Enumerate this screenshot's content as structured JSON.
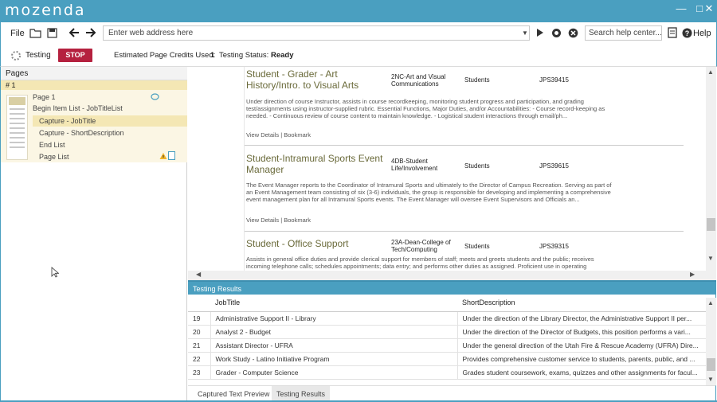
{
  "app": {
    "logo": "mozenda",
    "win_minimize": "—",
    "win_maximize": "□",
    "win_close": "✕"
  },
  "toolbar": {
    "file_label": "File",
    "address_placeholder": "Enter web address here",
    "search_placeholder": "Search help center...",
    "help_label": "Help",
    "icons": [
      "open-folder-icon",
      "save-icon",
      "back-arrow-icon",
      "forward-arrow-icon",
      "play-icon",
      "refresh-icon",
      "stop-circle-icon",
      "document-icon",
      "help-circle-icon"
    ]
  },
  "status": {
    "testing_label": "Testing",
    "stop_label": "STOP",
    "credits_label": "Estimated Page Credits Used:",
    "credits_value": "1",
    "status_label": "Testing Status:",
    "status_value": "Ready"
  },
  "pages_panel": {
    "header": "Pages",
    "page_number": "# 1",
    "items": [
      "Page 1",
      "Begin Item List - JobTitleList",
      "Capture - JobTitle",
      "Capture - ShortDescription",
      "End List",
      "Page List"
    ],
    "selected_index": 2
  },
  "web_page": {
    "jobs": [
      {
        "title": "Student - Grader - Art History/Intro. to Visual Arts",
        "dept": "2NC-Art and Visual Communications",
        "type": "Students",
        "id": "JPS39415",
        "desc": "Under direction of course Instructor, assists in course recordkeeping, monitoring student progress and participation, and grading test/assignments using instructor-supplied rubric. Essential Functions, Major Duties, and/or Accountabilities: - Course record-keeping as needed. - Continuous review of course content to maintain knowledge. - Logistical student interactions through email/ph...",
        "links": "View Details | Bookmark"
      },
      {
        "title": "Student-Intramural Sports Event Manager",
        "dept": "4DB-Student Life/Involvement",
        "type": "Students",
        "id": "JPS39615",
        "desc": "The Event Manager reports to the Coordinator of Intramural Sports and ultimately to the Director of Campus Recreation. Serving as part of an Event Management team consisting of six (3-6) individuals, the group is responsible for developing and implementing a comprehensive event management plan for all Intramural Sports events. The Event Manager will oversee Event Supervisors and Officials an...",
        "links": "View Details | Bookmark"
      },
      {
        "title": "Student - Office Support",
        "dept": "23A-Dean-College of Tech/Computing",
        "type": "Students",
        "id": "JPS39315",
        "desc": "Assists in general office duties and provide clerical support for members of staff; meets and greets students and the public; receives incoming telephone calls; schedules appointments; data entry; and performs other duties as assigned. Proficient use in operating",
        "links": ""
      }
    ]
  },
  "results": {
    "header": "Testing Results",
    "columns": [
      "",
      "JobTitle",
      "ShortDescription"
    ],
    "rows": [
      [
        "19",
        "Administrative Support II - Library",
        "Under the direction of the Library Director, the Administrative Support II per..."
      ],
      [
        "20",
        "Analyst 2 - Budget",
        "Under the direction of the Director of Budgets, this position performs a vari..."
      ],
      [
        "21",
        "Assistant Director - UFRA",
        "Under the general direction of the Utah Fire & Rescue Academy (UFRA) Dire..."
      ],
      [
        "22",
        "Work Study - Latino Initiative Program",
        "Provides comprehensive customer service to students, parents, public, and ..."
      ],
      [
        "23",
        "Grader - Computer Science",
        "Grades student coursework, exams, quizzes and other assignments for facul..."
      ]
    ]
  },
  "tabs": {
    "captured": "Captured Text Preview",
    "results": "Testing Results"
  }
}
